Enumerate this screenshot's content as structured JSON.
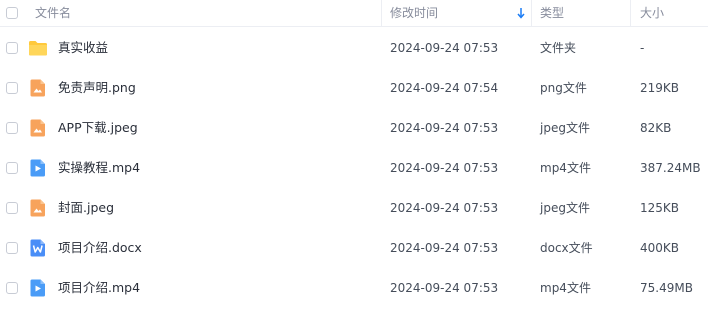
{
  "header": {
    "col_name": "文件名",
    "col_time": "修改时间",
    "col_type": "类型",
    "col_size": "大小"
  },
  "files": [
    {
      "name": "真实收益",
      "icon": "folder-icon",
      "time": "2024-09-24 07:53",
      "type": "文件夹",
      "size": "-"
    },
    {
      "name": "免责声明.png",
      "icon": "image-file-icon",
      "time": "2024-09-24 07:54",
      "type": "png文件",
      "size": "219KB"
    },
    {
      "name": "APP下载.jpeg",
      "icon": "image-file-icon",
      "time": "2024-09-24 07:53",
      "type": "jpeg文件",
      "size": "82KB"
    },
    {
      "name": "实操教程.mp4",
      "icon": "video-file-icon",
      "time": "2024-09-24 07:53",
      "type": "mp4文件",
      "size": "387.24MB"
    },
    {
      "name": "封面.jpeg",
      "icon": "image-file-icon",
      "time": "2024-09-24 07:53",
      "type": "jpeg文件",
      "size": "125KB"
    },
    {
      "name": "项目介绍.docx",
      "icon": "word-file-icon",
      "time": "2024-09-24 07:53",
      "type": "docx文件",
      "size": "400KB"
    },
    {
      "name": "项目介绍.mp4",
      "icon": "video-file-icon",
      "time": "2024-09-24 07:53",
      "type": "mp4文件",
      "size": "75.49MB"
    }
  ],
  "colors": {
    "folder": "#ffc93c",
    "image": "#f7a35c",
    "video": "#4a9cf7",
    "word": "#4a8ef7",
    "sort_arrow": "#1a7cf5"
  }
}
